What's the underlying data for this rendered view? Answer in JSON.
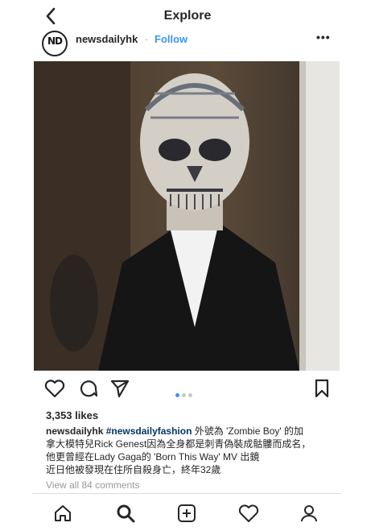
{
  "header": {
    "title": "Explore"
  },
  "post": {
    "username": "newsdailyhk",
    "separator": "·",
    "follow_label": "Follow",
    "more_label": "•••",
    "avatar_text": "ND",
    "likes": "3,353 likes",
    "caption": {
      "username": "newsdailyhk",
      "hashtag": "#newsdailyfashion",
      "line1_rest": " 外號為 'Zombie Boy' 的加",
      "line2": "拿大模特兒Rick Genest因為全身都是刺青偽裝成骷髏而成名，",
      "line3": "他更曾經在Lady Gaga的 'Born This Way' MV 出鏡",
      "line4": "近日他被發現在住所自殺身亡，終年32歲"
    },
    "view_comments": "View all 84 comments",
    "carousel": {
      "count": 3,
      "active": 0
    }
  },
  "icons": {
    "back": "chevron-left-icon",
    "like": "heart-icon",
    "comment": "comment-icon",
    "share": "send-icon",
    "save": "bookmark-icon",
    "nav": [
      "home-icon",
      "search-icon",
      "add-post-icon",
      "activity-heart-icon",
      "profile-icon"
    ]
  },
  "colors": {
    "accent": "#3897f0",
    "text": "#262626",
    "muted": "#999999",
    "hashtag": "#003569"
  }
}
